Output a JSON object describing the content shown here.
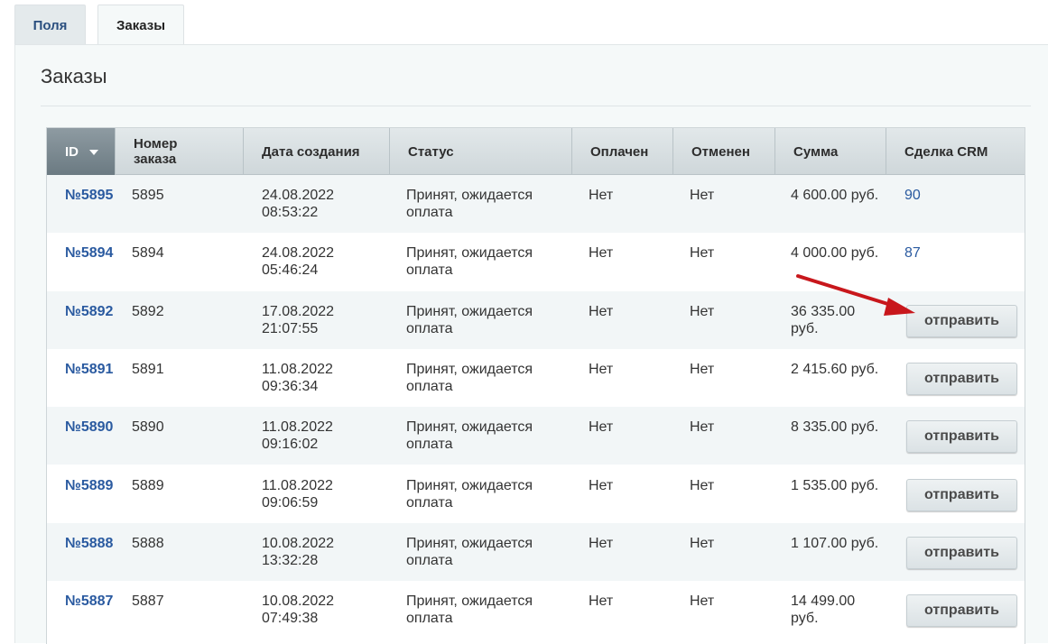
{
  "tabs": [
    {
      "label": "Поля",
      "active": false
    },
    {
      "label": "Заказы",
      "active": true
    }
  ],
  "page": {
    "title": "Заказы"
  },
  "table": {
    "columns": {
      "id": "ID",
      "order_number": "Номер заказа",
      "created": "Дата создания",
      "status": "Статус",
      "paid": "Оплачен",
      "cancelled": "Отменен",
      "sum": "Сумма",
      "crm": "Сделка CRM"
    },
    "sort_icon": "sort-desc-arrow",
    "rows": [
      {
        "id": "№5895",
        "number": "5895",
        "date": "24.08.2022",
        "time": "08:53:22",
        "status": "Принят, ожидается оплата",
        "paid": "Нет",
        "cancelled": "Нет",
        "sum": "4 600.00 руб.",
        "crm": "90",
        "button": ""
      },
      {
        "id": "№5894",
        "number": "5894",
        "date": "24.08.2022",
        "time": "05:46:24",
        "status": "Принят, ожидается оплата",
        "paid": "Нет",
        "cancelled": "Нет",
        "sum": "4 000.00 руб.",
        "crm": "87",
        "button": ""
      },
      {
        "id": "№5892",
        "number": "5892",
        "date": "17.08.2022",
        "time": "21:07:55",
        "status": "Принят, ожидается оплата",
        "paid": "Нет",
        "cancelled": "Нет",
        "sum": "36 335.00 руб.",
        "crm": "",
        "button": "отправить"
      },
      {
        "id": "№5891",
        "number": "5891",
        "date": "11.08.2022",
        "time": "09:36:34",
        "status": "Принят, ожидается оплата",
        "paid": "Нет",
        "cancelled": "Нет",
        "sum": "2 415.60 руб.",
        "crm": "",
        "button": "отправить"
      },
      {
        "id": "№5890",
        "number": "5890",
        "date": "11.08.2022",
        "time": "09:16:02",
        "status": "Принят, ожидается оплата",
        "paid": "Нет",
        "cancelled": "Нет",
        "sum": "8 335.00 руб.",
        "crm": "",
        "button": "отправить"
      },
      {
        "id": "№5889",
        "number": "5889",
        "date": "11.08.2022",
        "time": "09:06:59",
        "status": "Принят, ожидается оплата",
        "paid": "Нет",
        "cancelled": "Нет",
        "sum": "1 535.00 руб.",
        "crm": "",
        "button": "отправить"
      },
      {
        "id": "№5888",
        "number": "5888",
        "date": "10.08.2022",
        "time": "13:32:28",
        "status": "Принят, ожидается оплата",
        "paid": "Нет",
        "cancelled": "Нет",
        "sum": "1 107.00 руб.",
        "crm": "",
        "button": "отправить"
      },
      {
        "id": "№5887",
        "number": "5887",
        "date": "10.08.2022",
        "time": "07:49:38",
        "status": "Принят, ожидается оплата",
        "paid": "Нет",
        "cancelled": "Нет",
        "sum": "14 499.00 руб.",
        "crm": "",
        "button": "отправить"
      }
    ]
  },
  "annotation": {
    "icon": "red-arrow-icon",
    "color": "#c8171c"
  },
  "colors": {
    "link": "#2a5aa0",
    "header_id_bg": "#7d8b92"
  }
}
